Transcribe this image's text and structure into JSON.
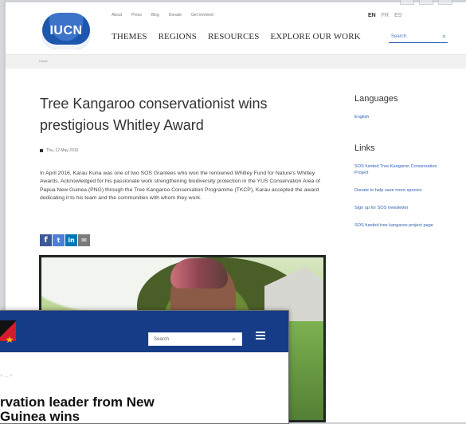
{
  "back": {
    "logo_text": "IUCN",
    "utility_nav": [
      "About",
      "Press",
      "Blog",
      "Donate",
      "Get involved"
    ],
    "languages": [
      "EN",
      "FR",
      "ES"
    ],
    "main_nav": [
      "THEMES",
      "REGIONS",
      "RESOURCES",
      "EXPLORE OUR WORK"
    ],
    "search_placeholder": "Search",
    "breadcrumb": "Home",
    "title": "Tree Kangaroo conservationist wins prestigious Whitley Award",
    "date": "Thu, 12 May 2016",
    "body": "In April 2016, Karau Kuna was one of two SOS Grantees who won the renowned Whitley Fund for Nature's Whitley Awards. Acknowledged for his passionate work strengthening biodiversity protection in the YUS Conservation Area of Papua New Guinea (PNG) through the Tree Kangaroo Conservation Programme (TKCP), Karau accepted the award dedicating it to his team and the communities with whom they work.",
    "share": [
      "f",
      "t",
      "in",
      "✉"
    ],
    "sidebar": {
      "languages_heading": "Languages",
      "languages_link": "English",
      "links_heading": "Links",
      "links": [
        "SOS funded Tree Kangaroo Conservation Project",
        "Donate to help save more species",
        "Sign up for SOS newsletter",
        "SOS funded tree kangaroo project page"
      ]
    }
  },
  "front": {
    "search_placeholder": "Search",
    "breadcrumb": "> ... >",
    "title": "rvation leader from New Guinea wins"
  }
}
